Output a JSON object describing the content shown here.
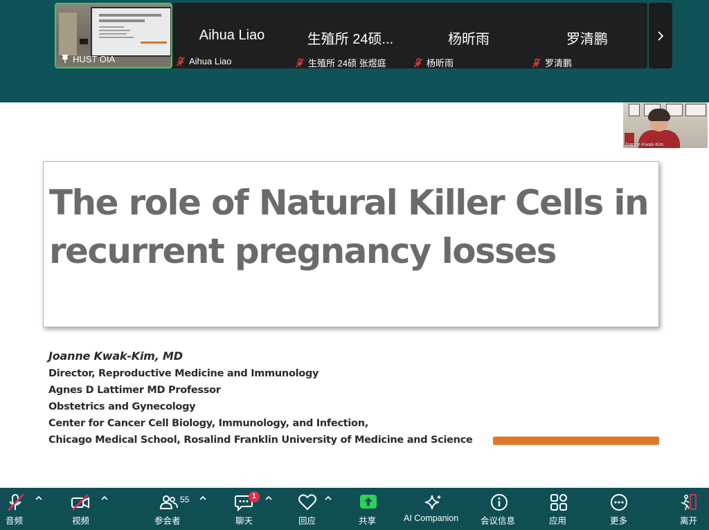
{
  "gallery": {
    "tiles": [
      {
        "name": "HUST OIA",
        "type": "video",
        "pinned": true
      },
      {
        "display_name": "Aihua Liao",
        "label": "Aihua Liao",
        "muted": true
      },
      {
        "display_name": "生殖所 24硕...",
        "label": "生殖所 24硕 张煜庭",
        "muted": true
      },
      {
        "display_name": "杨昕雨",
        "label": "杨昕雨",
        "muted": true
      },
      {
        "display_name": "罗清鹏",
        "label": "罗清鹏",
        "muted": true
      }
    ],
    "next_icon": "chevron-right-icon",
    "active_speaker_color": "#2fd158"
  },
  "slide": {
    "title_line1": "The role of Natural Killer Cells in",
    "title_line2": "recurrent pregnancy losses",
    "author": "Joanne Kwak-Kim, MD",
    "affiliations": [
      "Director, Reproductive Medicine and Immunology",
      "Agnes D Lattimer MD Professor",
      "Obstetrics and Gynecology",
      "Center for Cancer Cell Biology, Immunology, and Infection,",
      "Chicago Medical School, Rosalind Franklin University of Medicine and Science"
    ],
    "accent_color": "#e0782f",
    "speaker_thumbnail_name": "Joanne Kwak-Kim"
  },
  "toolbar": {
    "audio": "音频",
    "video": "视频",
    "participants": "参会者",
    "participants_count": "55",
    "chat": "聊天",
    "chat_badge": "1",
    "reactions": "回应",
    "share": "共享",
    "ai_companion": "AI Companion",
    "meeting_info": "会议信息",
    "apps": "应用",
    "more": "更多",
    "leave": "离开",
    "share_color": "#2fd158",
    "leave_color": "#e12e4b"
  }
}
